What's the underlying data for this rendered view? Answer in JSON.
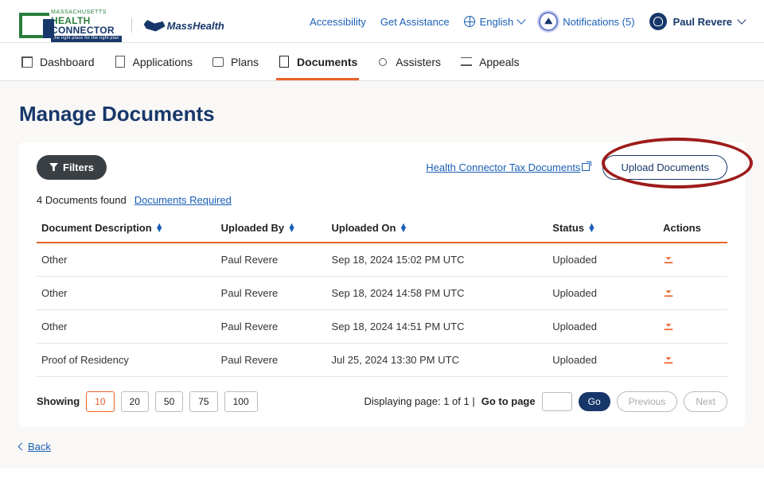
{
  "header": {
    "brand1": {
      "small": "MASSACHUSETTS",
      "line1": "HEALTH",
      "line2": "CONNECTOR",
      "tagline": "the right place for the right plan"
    },
    "brand2": "MassHealth",
    "accessibility": "Accessibility",
    "assistance": "Get Assistance",
    "language": "English",
    "notifications": "Notifications (5)",
    "user": "Paul Revere"
  },
  "nav": {
    "dashboard": "Dashboard",
    "applications": "Applications",
    "plans": "Plans",
    "documents": "Documents",
    "assisters": "Assisters",
    "appeals": "Appeals"
  },
  "page": {
    "title": "Manage Documents",
    "filters": "Filters",
    "tax_link": "Health Connector Tax Documents",
    "upload": "Upload Documents",
    "count": "4 Documents found",
    "required_link": "Documents Required",
    "columns": {
      "desc": "Document Description",
      "by": "Uploaded By",
      "on": "Uploaded On",
      "status": "Status",
      "actions": "Actions"
    },
    "rows": [
      {
        "desc": "Other",
        "by": "Paul Revere",
        "on": "Sep 18, 2024 15:02 PM UTC",
        "status": "Uploaded"
      },
      {
        "desc": "Other",
        "by": "Paul Revere",
        "on": "Sep 18, 2024 14:58 PM UTC",
        "status": "Uploaded"
      },
      {
        "desc": "Other",
        "by": "Paul Revere",
        "on": "Sep 18, 2024 14:51 PM UTC",
        "status": "Uploaded"
      },
      {
        "desc": "Proof of Residency",
        "by": "Paul Revere",
        "on": "Jul 25, 2024 13:30 PM UTC",
        "status": "Uploaded"
      }
    ],
    "showing": "Showing",
    "sizes": [
      "10",
      "20",
      "50",
      "75",
      "100"
    ],
    "displaying": "Displaying page: 1 of 1   |",
    "goto": "Go to page",
    "go": "Go",
    "prev": "Previous",
    "next": "Next",
    "back": "Back"
  }
}
